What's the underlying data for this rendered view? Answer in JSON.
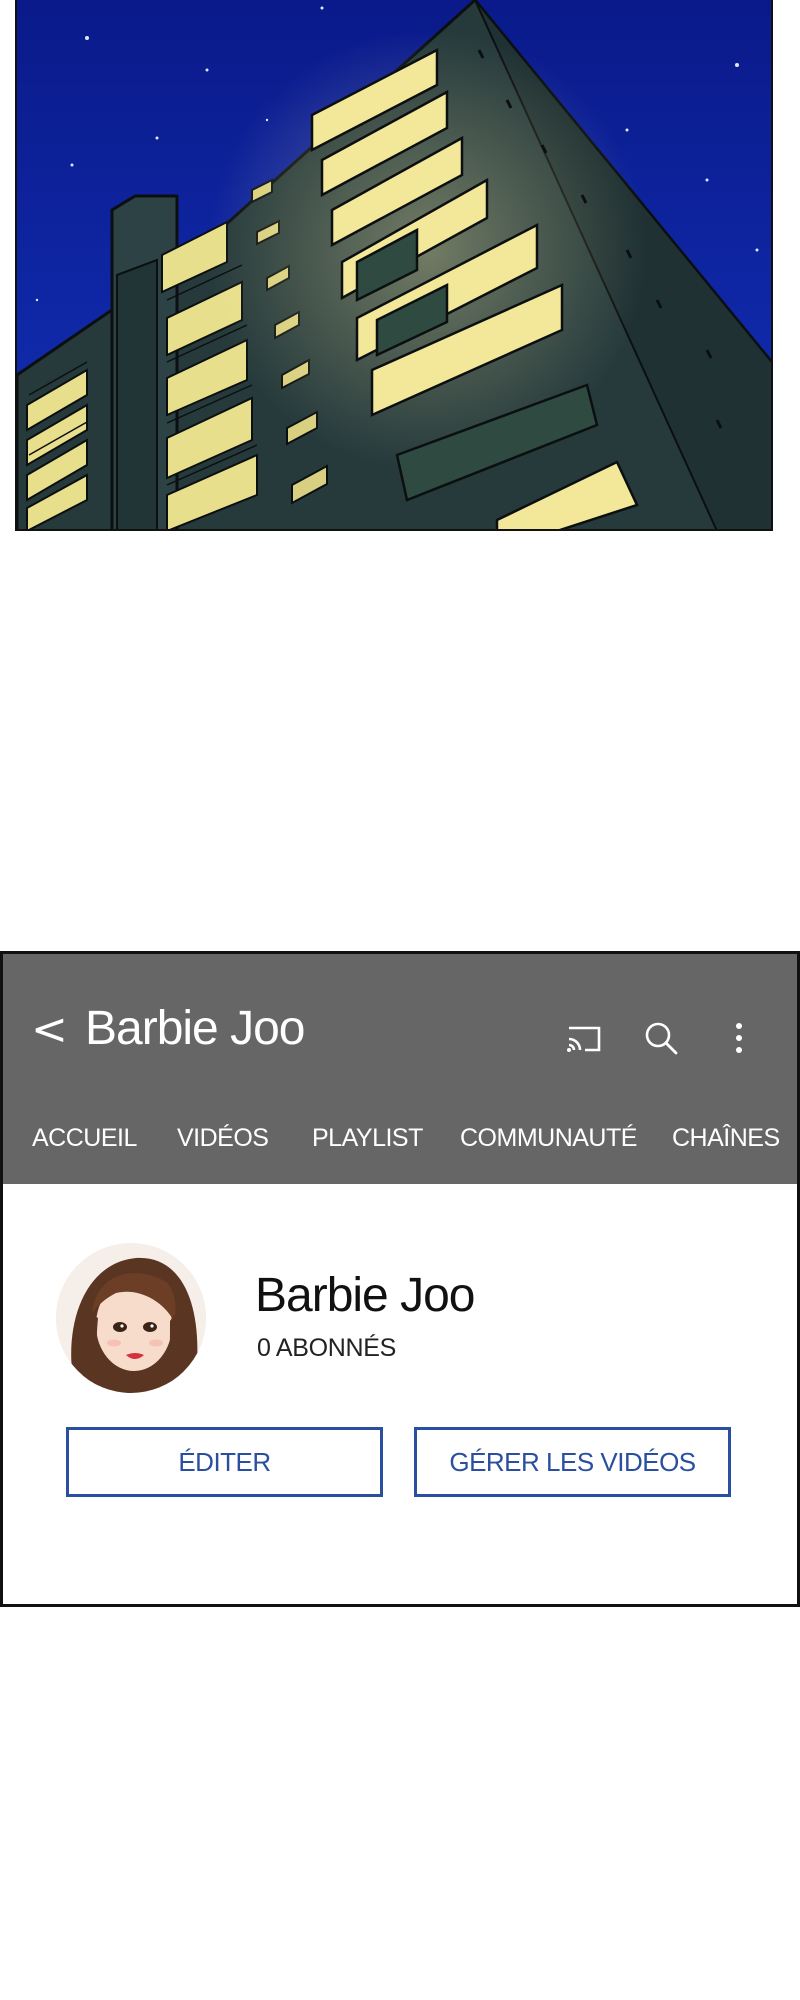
{
  "comic": {
    "scene": "night-sky-building-illustration",
    "colors": {
      "sky": "#0d1f9a",
      "building": "#263a3c",
      "window_light": "#f3e79a"
    }
  },
  "app": {
    "title": "Barbie Joo",
    "icons": {
      "back": "chevron-left-icon",
      "cast": "cast-icon",
      "search": "search-icon",
      "more": "more-vertical-icon"
    },
    "tabs": [
      {
        "label": "ACCUEIL"
      },
      {
        "label": "VIDÉOS"
      },
      {
        "label": "PLAYLIST"
      },
      {
        "label": "COMMUNAUTÉ"
      },
      {
        "label": "CHAÎNES"
      }
    ],
    "colors": {
      "appbar": "#666666",
      "accent": "#2a4fa0"
    }
  },
  "channel": {
    "name": "Barbie Joo",
    "subscribers": "0 ABONNÉS",
    "edit_label": "ÉDITER",
    "manage_label": "GÉRER LES VIDÉOS"
  }
}
